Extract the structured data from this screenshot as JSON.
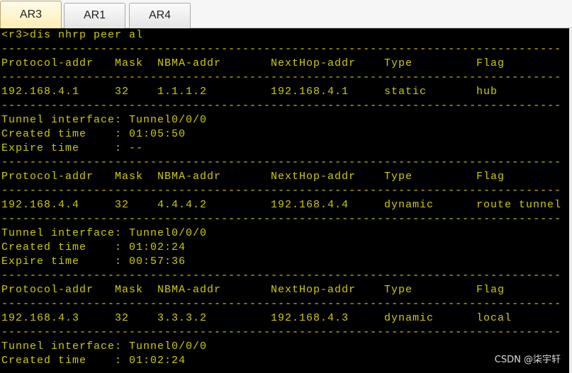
{
  "tabs": [
    {
      "label": "AR3",
      "active": true
    },
    {
      "label": "AR1",
      "active": false
    },
    {
      "label": "AR4",
      "active": false
    }
  ],
  "terminal": {
    "command": "<r3>dis nhrp peer al",
    "separator": "-------------------------------------------------------------------------------",
    "headers": {
      "protocol_addr": "Protocol-addr",
      "mask": "Mask",
      "nbma_addr": "NBMA-addr",
      "nexthop_addr": "NextHop-addr",
      "type": "Type",
      "flag": "Flag"
    },
    "labels": {
      "tunnel_interface": "Tunnel interface:",
      "created_time": "Created time",
      "expire_time": "Expire time",
      "colon": ":"
    },
    "peers": [
      {
        "protocol_addr": "192.168.4.1",
        "mask": "32",
        "nbma_addr": "1.1.1.2",
        "nexthop_addr": "192.168.4.1",
        "type": "static",
        "flag": "hub",
        "tunnel": "Tunnel0/0/0",
        "created": "01:05:50",
        "expire": "--"
      },
      {
        "protocol_addr": "192.168.4.4",
        "mask": "32",
        "nbma_addr": "4.4.4.2",
        "nexthop_addr": "192.168.4.4",
        "type": "dynamic",
        "flag": "route tunnel",
        "tunnel": "Tunnel0/0/0",
        "created": "01:02:24",
        "expire": "00:57:36"
      },
      {
        "protocol_addr": "192.168.4.3",
        "mask": "32",
        "nbma_addr": "3.3.3.2",
        "nexthop_addr": "192.168.4.3",
        "type": "dynamic",
        "flag": "local",
        "tunnel": "Tunnel0/0/0",
        "created": "01:02:24"
      }
    ]
  },
  "watermark": "CSDN @柒宇轩",
  "colors": {
    "terminal_bg": "#000000",
    "terminal_text": "#cccc00",
    "active_tab_top": "#fffbe8",
    "active_tab_bottom": "#fdeeb5"
  }
}
